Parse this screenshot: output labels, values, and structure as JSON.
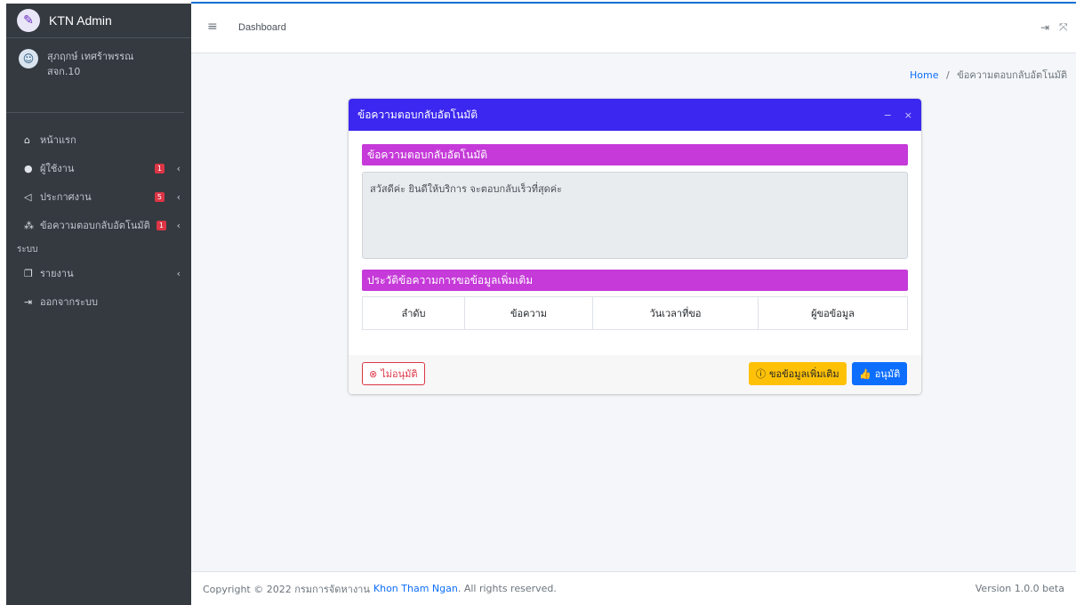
{
  "brand": {
    "logo_icon": "department-logo-icon",
    "name": "KTN Admin"
  },
  "user": {
    "name": "สุภฤกษ์ เทศร้าพรรณ",
    "role": "สจก.10",
    "avatar_icon": "user-avatar-icon"
  },
  "sidebar": {
    "items": [
      {
        "label": "หน้าแรก",
        "icon": "home-icon"
      },
      {
        "label": "ผู้ใช้งาน",
        "icon": "user-circle-icon",
        "badge": "1"
      },
      {
        "label": "ประกาศงาน",
        "icon": "bullhorn-icon",
        "badge": "5"
      },
      {
        "label": "ข้อความตอบกลับอัตโนมัติ",
        "icon": "users-icon",
        "badge": "1"
      }
    ],
    "section_header": "ระบบ",
    "system_items": [
      {
        "label": "รายงาน",
        "icon": "clone-icon"
      },
      {
        "label": "ออกจากระบบ",
        "icon": "sign-out-icon"
      }
    ]
  },
  "header": {
    "nav_link": "Dashboard",
    "hamburger_icon": "bars-icon",
    "logout_icon": "sign-out-icon",
    "fullscreen_icon": "expand-icon"
  },
  "breadcrumb": {
    "home": "Home",
    "separator": "/",
    "current": "ข้อความตอบกลับอัตโนมัติ"
  },
  "card": {
    "title": "ข้อความตอบกลับอัตโนมัติ",
    "collapse_symbol": "−",
    "close_symbol": "×",
    "section1_title": "ข้อความตอบกลับอัตโนมัติ",
    "message_text": "สวัสดีค่ะ ยินดีให้บริการ จะตอบกลับเร็วที่สุดค่ะ",
    "section2_title": "ประวัติข้อความการขอข้อมูลเพิ่มเติม",
    "table_headers": [
      "ลำดับ",
      "ข้อความ",
      "วันเวลาที่ขอ",
      "ผู้ขอข้อมูล"
    ],
    "buttons": {
      "reject": "ไม่อนุมัติ",
      "request_more": "ขอข้อมูลเพิ่มเติม",
      "approve": "อนุมัติ"
    }
  },
  "footer": {
    "copyright_prefix": "Copyright © 2022 กรมการจัดหางาน",
    "org_link": "Khon Tham Ngan",
    "rights": ". All rights reserved.",
    "version": "Version 1.0.0 beta"
  },
  "colors": {
    "sidebar_bg": "#343a40",
    "card_header": "#3b27ef",
    "section_bar": "#c53ad8",
    "primary": "#0d6efd",
    "warning": "#ffc107",
    "danger": "#dc3545"
  }
}
